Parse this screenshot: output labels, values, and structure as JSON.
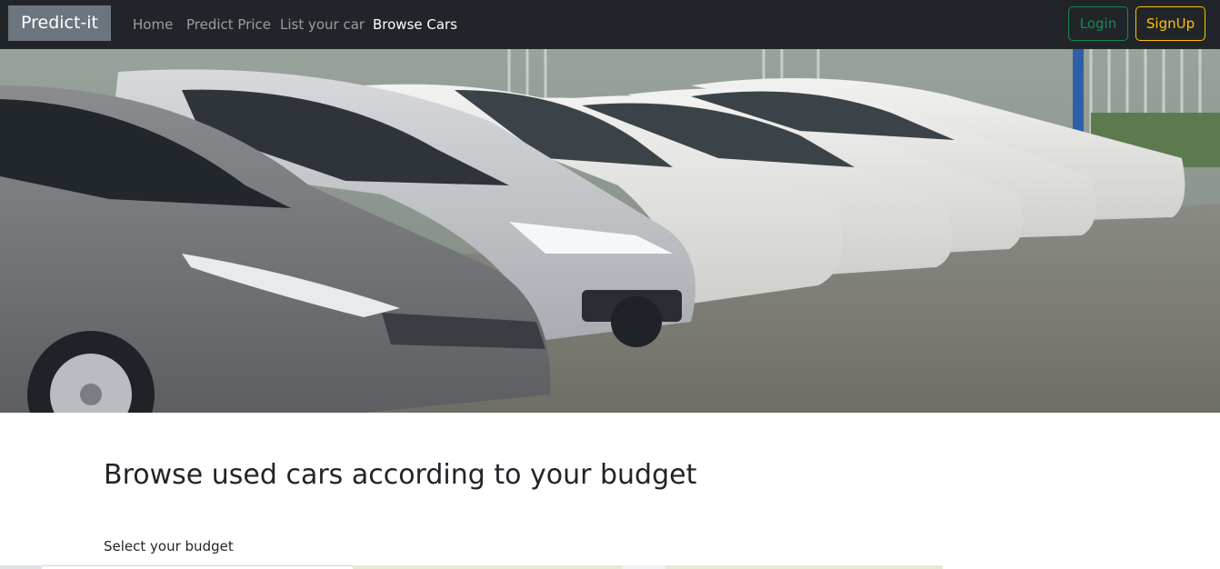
{
  "navbar": {
    "brand": "Predict-it",
    "links": [
      {
        "label": "Home",
        "active": false
      },
      {
        "label": "Predict Price",
        "active": false
      },
      {
        "label": "List your car",
        "active": false
      },
      {
        "label": "Browse Cars",
        "active": true
      }
    ],
    "login_label": "Login",
    "signup_label": "SignUp"
  },
  "hero": {
    "image": "used-cars-parking-lot-photo"
  },
  "main": {
    "heading": "Browse used cars according to your budget",
    "budget_label": "Select your budget"
  },
  "colors": {
    "navbar_bg": "#212529",
    "brand_bg": "#6c757d",
    "login_border": "#198754",
    "signup_border": "#ffc107"
  }
}
